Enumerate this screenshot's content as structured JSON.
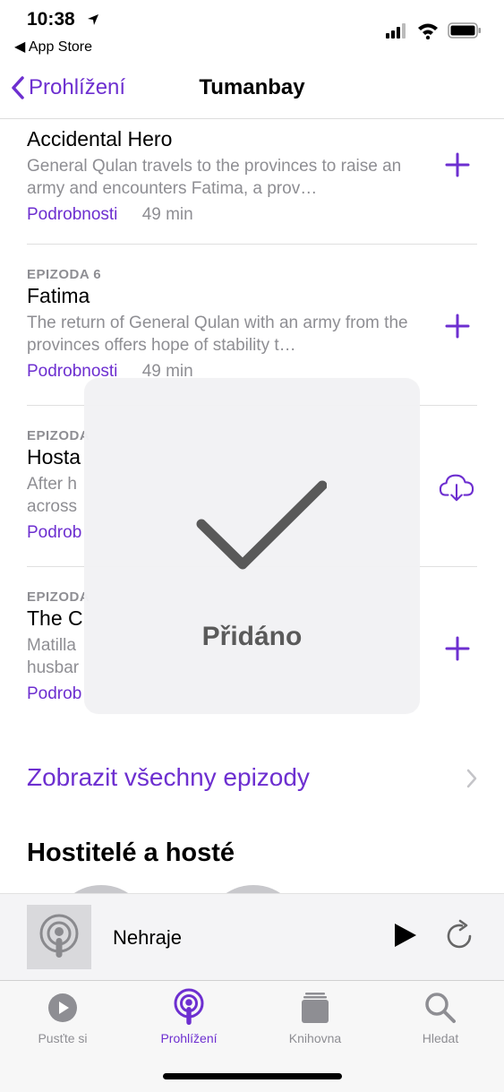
{
  "status_bar": {
    "time": "10:38",
    "back_app": "◀ App Store"
  },
  "nav": {
    "back_label": "Prohlížení",
    "title": "Tumanbay"
  },
  "episodes": [
    {
      "label": "",
      "title": "Accidental Hero",
      "desc": "General Qulan travels to the provinces to raise an army and encounters Fatima, a prov…",
      "detail": "Podrobnosti",
      "duration": "49 min",
      "action_icon": "plus-icon"
    },
    {
      "label": "EPIZODA 6",
      "title": "Fatima",
      "desc": "The return of General Qulan with an army from the provinces offers hope of stability t…",
      "detail": "Podrobnosti",
      "duration": "49 min",
      "action_icon": "plus-icon"
    },
    {
      "label": "EPIZODA",
      "title": "Hosta",
      "desc_lines": [
        "After h",
        "across"
      ],
      "detail": "Podrob",
      "action_icon": "cloud-download-icon"
    },
    {
      "label": "EPIZODA",
      "title": "The C",
      "desc_lines": [
        "Matilla",
        "husbar"
      ],
      "detail": "Podrob",
      "action_icon": "plus-icon"
    }
  ],
  "show_all": "Zobrazit všechny epizody",
  "hosts_title": "Hostitelé a hosté",
  "mini_player": {
    "title": "Nehraje"
  },
  "tabs": [
    {
      "label": "Pusťte si",
      "icon": "play-circle-icon",
      "active": false
    },
    {
      "label": "Prohlížení",
      "icon": "podcasts-icon",
      "active": true
    },
    {
      "label": "Knihovna",
      "icon": "library-icon",
      "active": false
    },
    {
      "label": "Hledat",
      "icon": "search-icon",
      "active": false
    }
  ],
  "hud": {
    "text": "Přidáno",
    "icon": "checkmark-icon"
  },
  "colors": {
    "accent": "#6d2fd0",
    "secondary_text": "#8e8e93"
  }
}
